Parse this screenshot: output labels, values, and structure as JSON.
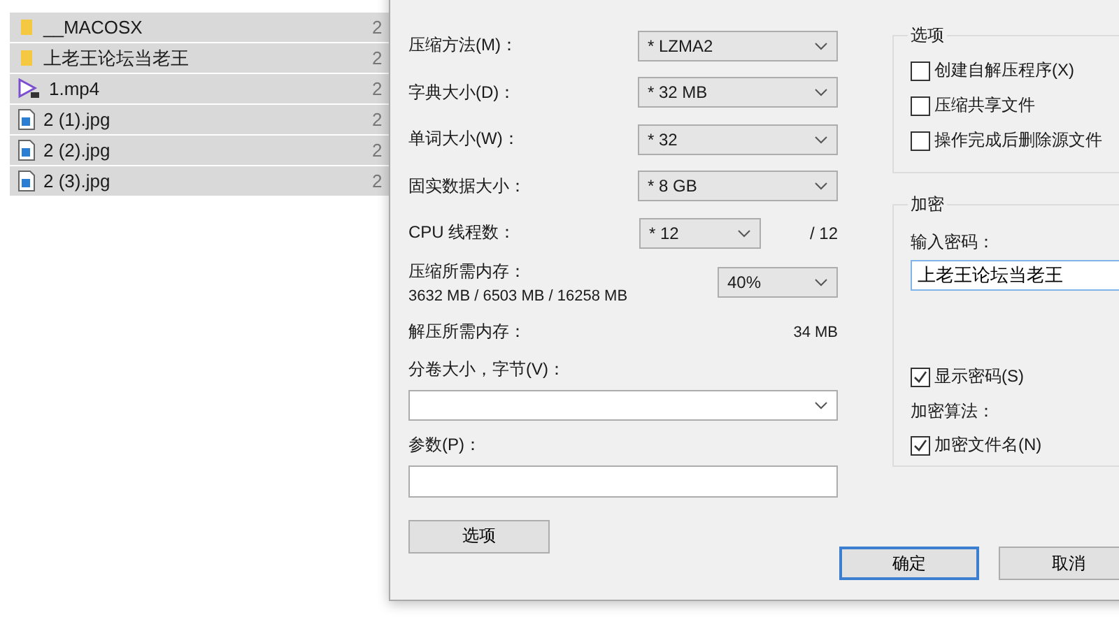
{
  "files": [
    {
      "name": "__MACOSX",
      "kind": "folder",
      "column_2": "2",
      "selected": true
    },
    {
      "name": "上老王论坛当老王",
      "kind": "folder",
      "column_2": "2",
      "selected": true
    },
    {
      "name": "1.mp4",
      "kind": "video",
      "column_2": "2",
      "selected": true
    },
    {
      "name": "2 (1).jpg",
      "kind": "image",
      "column_2": "2",
      "selected": true
    },
    {
      "name": "2 (2).jpg",
      "kind": "image",
      "column_2": "2",
      "selected": true
    },
    {
      "name": "2 (3).jpg",
      "kind": "image",
      "column_2": "2",
      "selected": true
    }
  ],
  "dialog": {
    "settings": [
      {
        "label": "压缩方法(M)：",
        "value": "* LZMA2"
      },
      {
        "label": "字典大小(D)：",
        "value": "* 32 MB"
      },
      {
        "label": "单词大小(W)：",
        "value": "* 32"
      },
      {
        "label": "固实数据大小：",
        "value": "* 8 GB"
      }
    ],
    "cpu": {
      "label": "CPU 线程数：",
      "value": "* 12",
      "total": "/ 12"
    },
    "memory": {
      "label": "压缩所需内存：",
      "detail": "3632 MB / 6503 MB / 16258 MB",
      "value": "40%"
    },
    "decompress": {
      "label": "解压所需内存：",
      "value": "34 MB"
    },
    "volume": {
      "label": "分卷大小，字节(V)："
    },
    "params": {
      "label": "参数(P)："
    },
    "options_button": "选项",
    "options_group": {
      "title": "选项",
      "checkboxes": [
        {
          "label": "创建自解压程序(X)",
          "checked": false
        },
        {
          "label": "压缩共享文件",
          "checked": false
        },
        {
          "label": "操作完成后删除源文件",
          "checked": false
        }
      ]
    },
    "encryption": {
      "title": "加密",
      "password_label": "输入密码：",
      "password": "上老王论坛当老王",
      "show_password": {
        "label": "显示密码(S)",
        "checked": true
      },
      "method_label": "加密算法：",
      "encrypt_names": {
        "label": "加密文件名(N)",
        "checked": true
      }
    },
    "buttons": [
      {
        "label": "确定",
        "default": true
      },
      {
        "label": "取消",
        "default": false
      }
    ]
  }
}
